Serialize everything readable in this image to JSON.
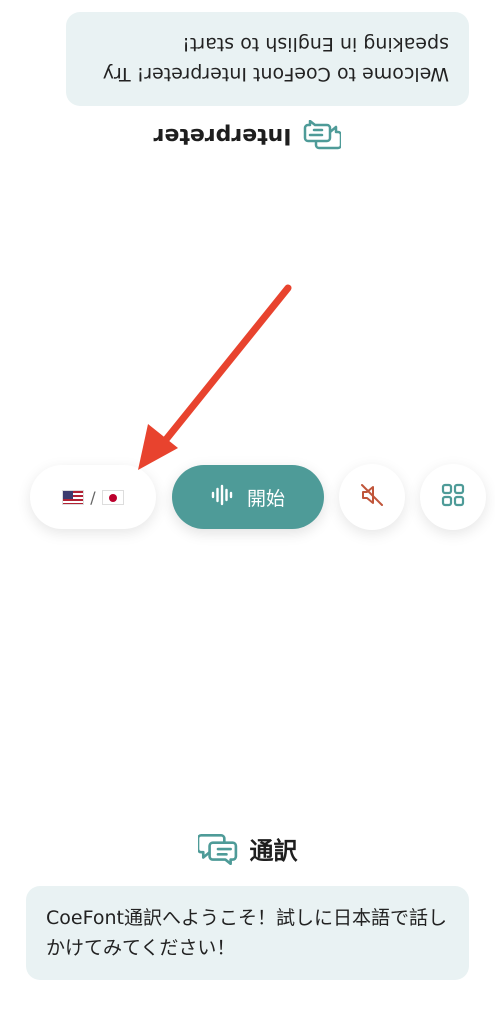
{
  "partner_side": {
    "section_title": "Interpreter",
    "message": "Welcome to CoeFont Interpreter! Try speaking in English to start!"
  },
  "own_side": {
    "section_title": "通訳",
    "message": "CoeFont通訳へようこそ！試しに日本語で話しかけてみてください！"
  },
  "controls": {
    "language_pair": {
      "source_flag": "us-flag",
      "separator": "/",
      "target_flag": "jp-flag"
    },
    "start_label": "開始",
    "start_icon": "waveform-icon",
    "mute_icon": "speaker-muted-icon",
    "menu_icon": "grid-icon"
  },
  "colors": {
    "accent": "#4e9b98",
    "bubble_bg": "#e9f2f3",
    "mute_icon": "#c0553a",
    "annotation_arrow": "#e8432e"
  }
}
